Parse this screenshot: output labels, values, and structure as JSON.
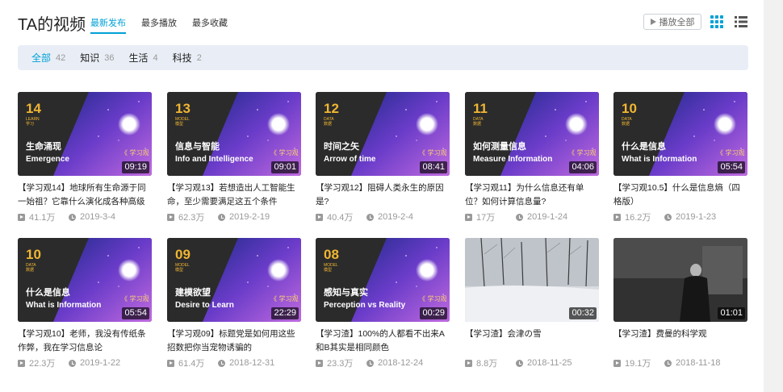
{
  "page_title": "TA的视频",
  "sort_tabs": [
    {
      "label": "最新发布",
      "active": true
    },
    {
      "label": "最多播放",
      "active": false
    },
    {
      "label": "最多收藏",
      "active": false
    }
  ],
  "toolbar": {
    "play_all_label": "播放全部",
    "grid_view_icon": "grid-view-icon",
    "list_view_icon": "list-view-icon"
  },
  "filters": [
    {
      "label": "全部",
      "count": "42",
      "active": true
    },
    {
      "label": "知识",
      "count": "36",
      "active": false
    },
    {
      "label": "生活",
      "count": "4",
      "active": false
    },
    {
      "label": "科技",
      "count": "2",
      "active": false
    }
  ],
  "colors": {
    "accent": "#00a1d6",
    "thumb_number": "#f0b632"
  },
  "videos": [
    {
      "thumb_type": "series",
      "num": "14",
      "tag1": "LEARN",
      "tag2": "学习",
      "cn": "生命涌现",
      "en": "Emergence",
      "duration": "09:19",
      "title": "【学习观14】地球所有生命源于同一始祖？它靠什么演化成各种高级",
      "views": "41.1万",
      "date": "2019-3-4"
    },
    {
      "thumb_type": "series",
      "num": "13",
      "tag1": "MODEL",
      "tag2": "模型",
      "cn": "信息与智能",
      "en": "Info and Intelligence",
      "duration": "09:01",
      "title": "【学习观13】若想造出人工智能生命，至少需要满足这五个条件",
      "views": "62.3万",
      "date": "2019-2-19"
    },
    {
      "thumb_type": "series",
      "num": "12",
      "tag1": "DATA",
      "tag2": "数据",
      "cn": "时间之矢",
      "en": "Arrow of time",
      "duration": "08:41",
      "title": "【学习观12】阻碍人类永生的原因是?",
      "views": "40.4万",
      "date": "2019-2-4"
    },
    {
      "thumb_type": "series",
      "num": "11",
      "tag1": "DATA",
      "tag2": "数据",
      "cn": "如何测量信息",
      "en": "Measure Information",
      "duration": "04:06",
      "title": "【学习观11】为什么信息还有单位？如何计算信息量?",
      "views": "17万",
      "date": "2019-1-24"
    },
    {
      "thumb_type": "series",
      "num": "10",
      "tag1": "DATA",
      "tag2": "数据",
      "cn": "什么是信息",
      "en": "What is Information",
      "duration": "05:54",
      "title": "【学习观10.5】什么是信息熵（四格版）",
      "views": "16.2万",
      "date": "2019-1-23"
    },
    {
      "thumb_type": "series",
      "num": "10",
      "tag1": "DATA",
      "tag2": "数据",
      "cn": "什么是信息",
      "en": "What is Information",
      "duration": "05:54",
      "title": "【学习观10】老师，我没有传纸条作弊，我在学习信息论",
      "views": "22.3万",
      "date": "2019-1-22"
    },
    {
      "thumb_type": "series",
      "num": "09",
      "tag1": "MODEL",
      "tag2": "模型",
      "cn": "建模欲望",
      "en": "Desire to Learn",
      "duration": "22:29",
      "title": "【学习观09】标题党是如何用这些招数把你当宠物诱骗的",
      "views": "61.4万",
      "date": "2018-12-31"
    },
    {
      "thumb_type": "series",
      "num": "08",
      "tag1": "MODEL",
      "tag2": "模型",
      "cn": "感知与真实",
      "en": "Perception vs Reality",
      "duration": "00:29",
      "title": "【学习渣】100%的人都看不出来A和B其实是相同颜色",
      "views": "23.3万",
      "date": "2018-12-24"
    },
    {
      "thumb_type": "snow",
      "num": "",
      "tag1": "",
      "tag2": "",
      "cn": "",
      "en": "",
      "duration": "00:32",
      "title": "【学习渣】会津の雪",
      "views": "8.8万",
      "date": "2018-11-25"
    },
    {
      "thumb_type": "photo",
      "num": "",
      "tag1": "",
      "tag2": "",
      "cn": "",
      "en": "",
      "duration": "01:01",
      "title": "【学习渣】费曼的科学观",
      "views": "19.1万",
      "date": "2018-11-18"
    }
  ]
}
